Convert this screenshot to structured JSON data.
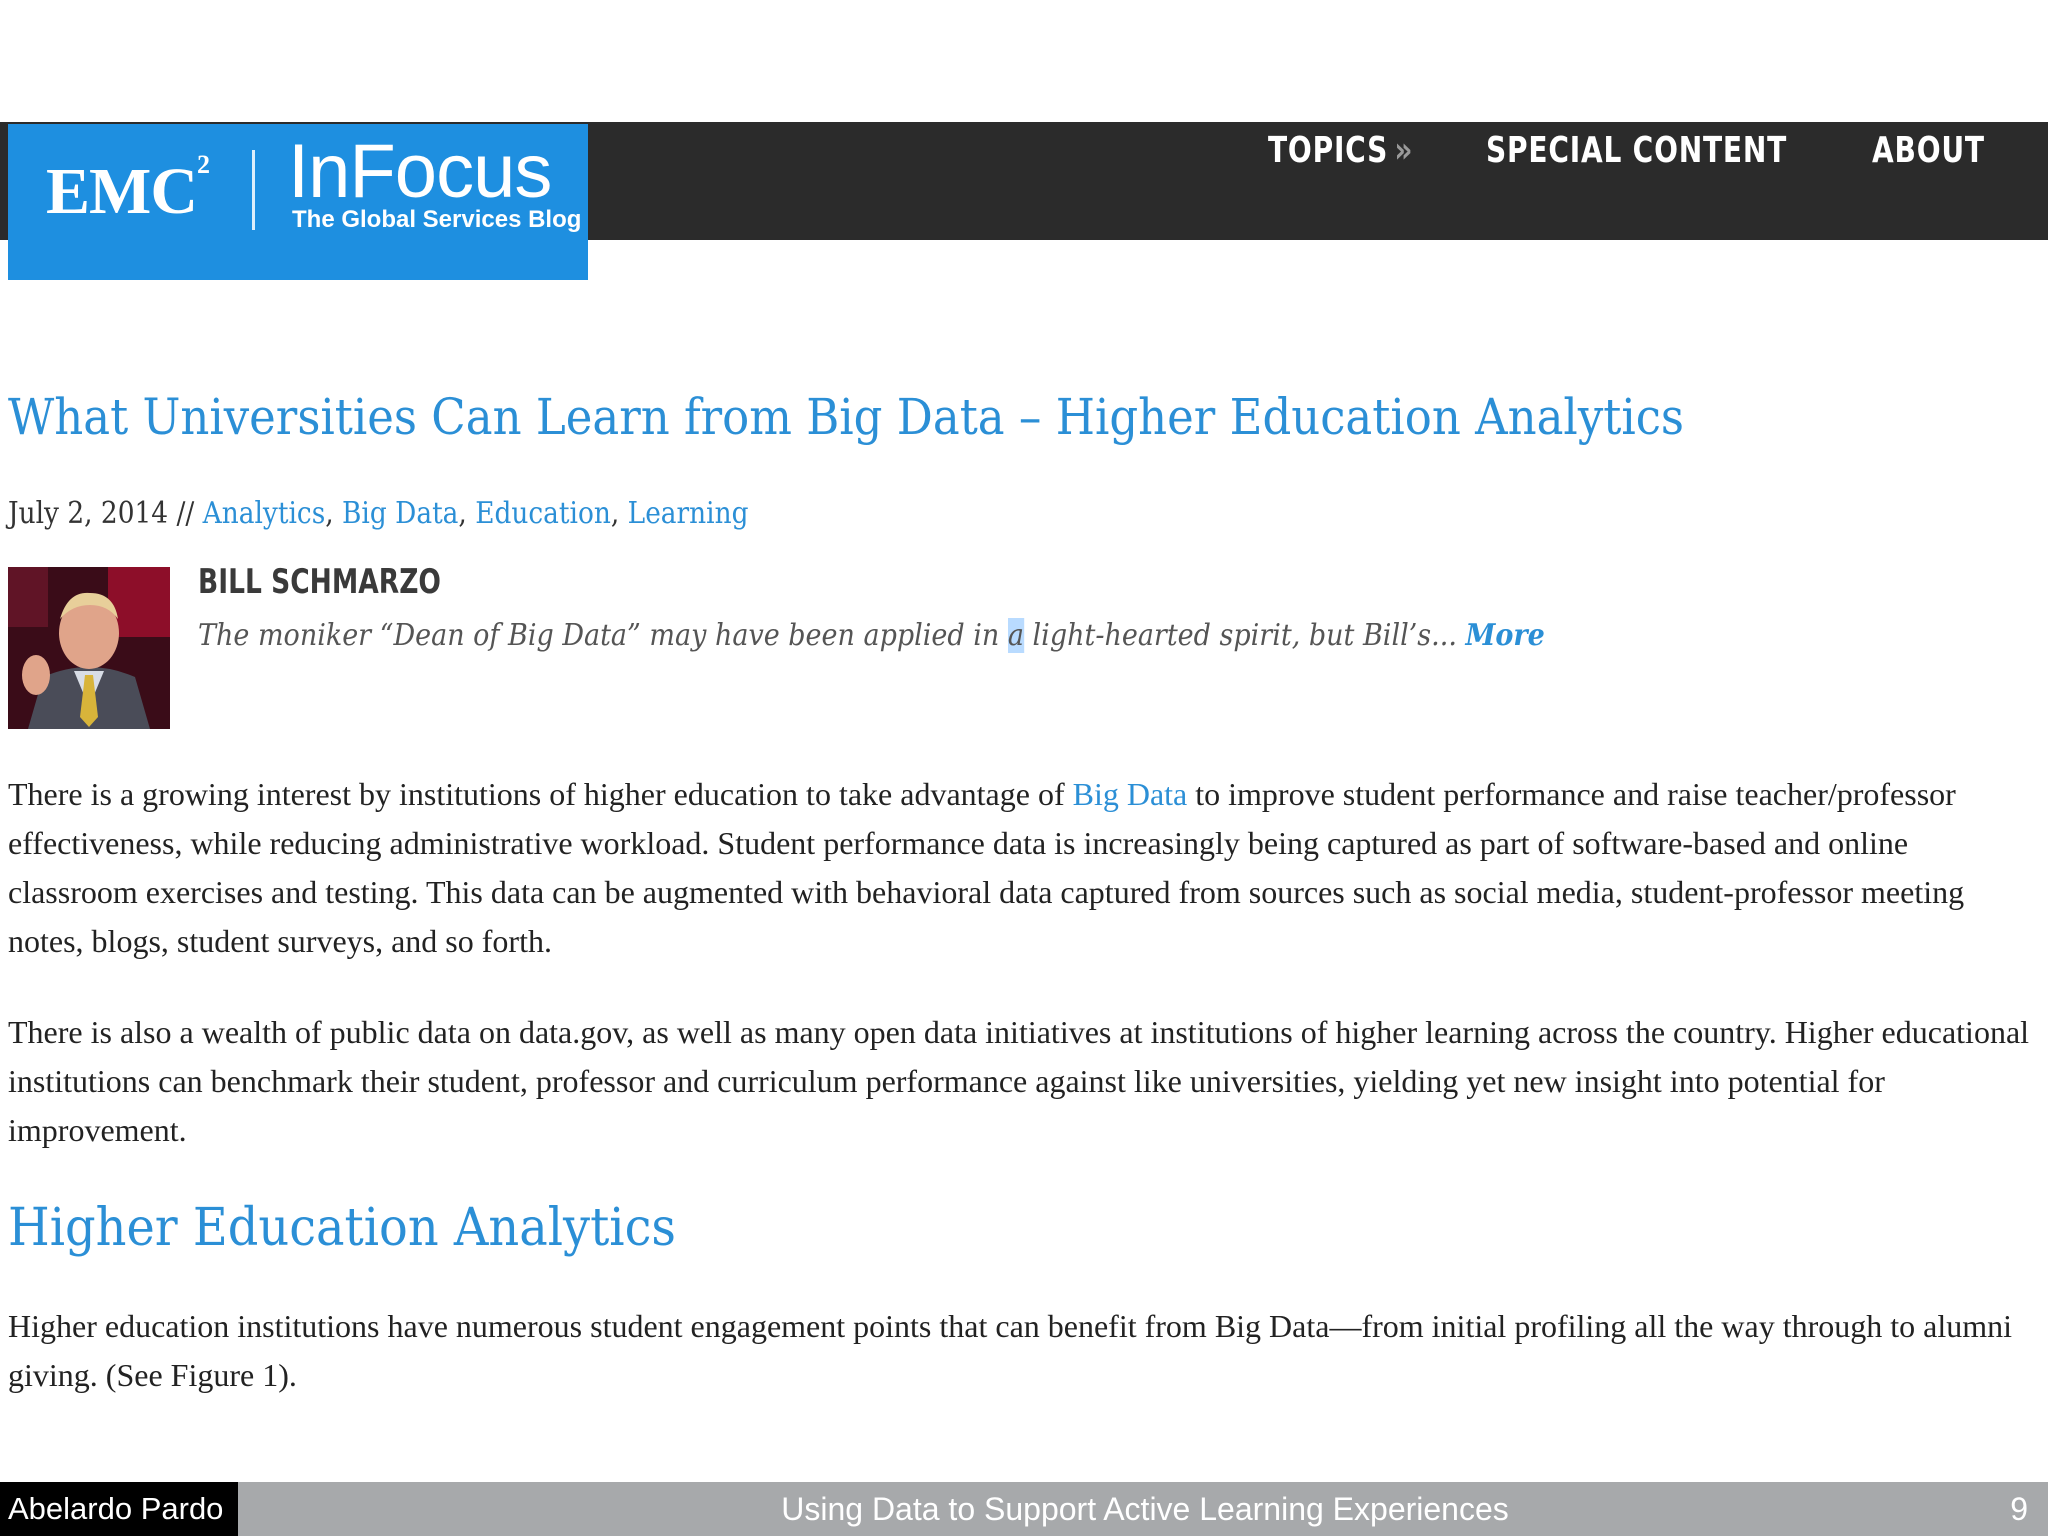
{
  "header": {
    "logo": {
      "brand": "EMC",
      "brand_sup": "2",
      "name": "InFocus",
      "tagline": "The Global Services Blog"
    },
    "nav": {
      "topics": "TOPICS",
      "topics_chevron": "»",
      "special": "SPECIAL CONTENT",
      "about": "ABOUT"
    }
  },
  "article": {
    "title": "What Universities Can Learn from Big Data – Higher Education Analytics",
    "date": "July 2, 2014",
    "separator": " // ",
    "tags": [
      "Analytics",
      "Big Data",
      "Education",
      "Learning"
    ],
    "author": {
      "name": "BILL SCHMARZO",
      "bio_before": "The moniker “Dean of Big Data” may have been applied in ",
      "bio_highlight": "a",
      "bio_after": " light-hearted spirit, but Bill’s... ",
      "more": "More"
    },
    "p1_before": "There is a growing interest by institutions of higher education to take advantage of ",
    "p1_link": "Big Data",
    "p1_after": " to improve student performance and raise teacher/professor effectiveness, while reducing administrative workload. Student performance data is increasingly being captured as part of software-based and online classroom exercises and testing. This data can be augmented with behavioral data captured from sources such as social media, student-professor meeting notes, blogs, student surveys, and so forth.",
    "p2": "There is also a wealth of public data on data.gov, as well as many open data initiatives at institutions of higher learning across the country. Higher educational institutions can benchmark their student, professor and curriculum performance against like universities, yielding yet new insight into potential for improvement.",
    "section_heading": "Higher Education Analytics",
    "p3": "Higher education institutions have numerous student engagement points that can benefit from Big Data—from initial profiling all the way through to alumni giving. (See Figure 1)."
  },
  "footer": {
    "presenter": "Abelardo Pardo",
    "title": "Using Data to Support Active Learning Experiences",
    "page": "9"
  },
  "colors": {
    "header_bar": "#2b2b2b",
    "logo_blue": "#1e8fe0",
    "link_blue": "#2b8fd6",
    "footer_bar": "#a7a9ab"
  }
}
